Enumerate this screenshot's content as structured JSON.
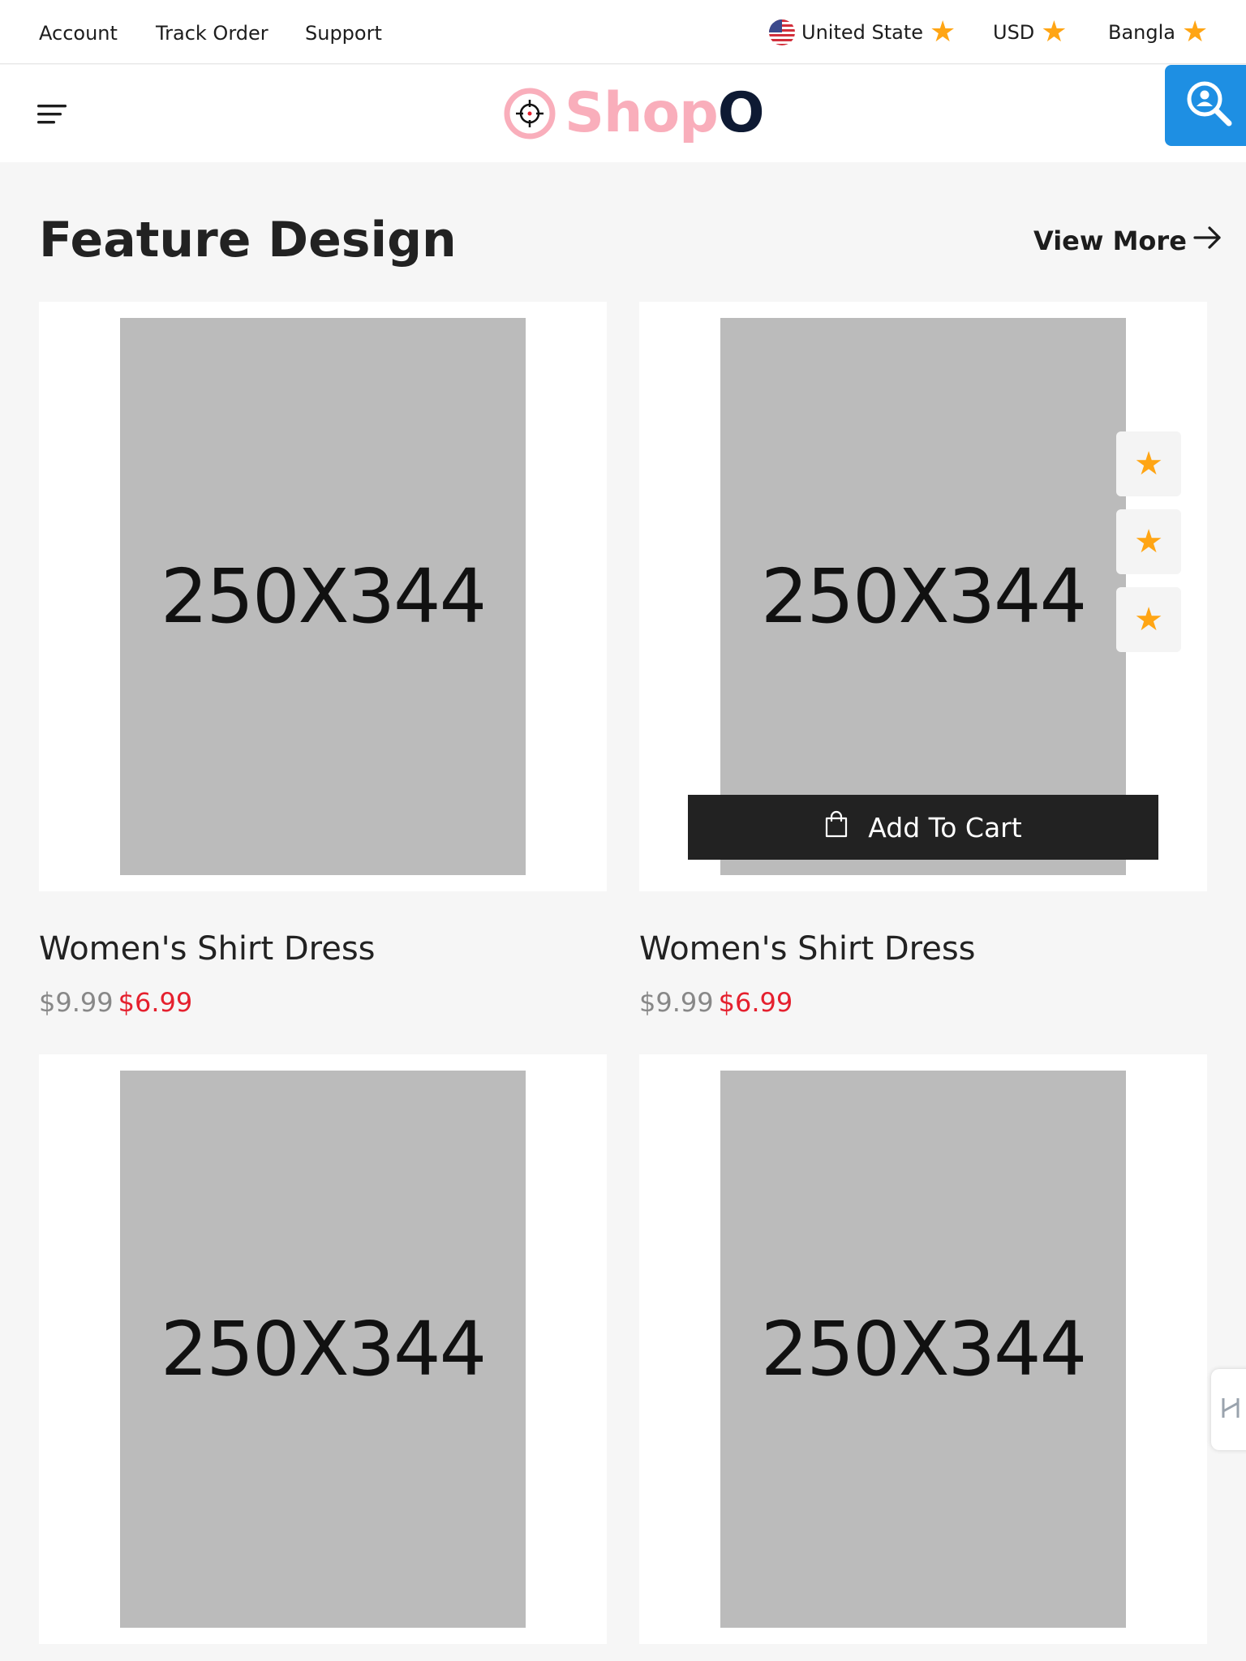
{
  "topbar": {
    "links": [
      "Account",
      "Track Order",
      "Support"
    ],
    "country": "United State",
    "currency": "USD",
    "language": "Bangla"
  },
  "header": {
    "logo_main": "Shop",
    "logo_end": "O"
  },
  "section": {
    "title": "Feature Design",
    "view_more": "View More"
  },
  "products": [
    {
      "image_label": "250X344",
      "name": "Women's Shirt Dress",
      "old_price": "$9.99",
      "new_price": "$6.99"
    },
    {
      "image_label": "250X344",
      "name": "Women's Shirt Dress",
      "old_price": "$9.99",
      "new_price": "$6.99",
      "add_to_cart": "Add To Cart"
    },
    {
      "image_label": "250X344"
    },
    {
      "image_label": "250X344"
    }
  ],
  "colors": {
    "accent_star": "#ffa514",
    "sale_price": "#e5202e",
    "search_button": "#1e8fe3",
    "logo_pink": "#f9aebb",
    "logo_navy": "#0e1a33",
    "cart_button": "#222222"
  },
  "icons": [
    "flag-us-icon",
    "star-icon",
    "menu-icon",
    "logo-target-icon",
    "search-user-icon",
    "arrow-right-icon",
    "shopping-bag-icon",
    "side-tab-icon"
  ]
}
